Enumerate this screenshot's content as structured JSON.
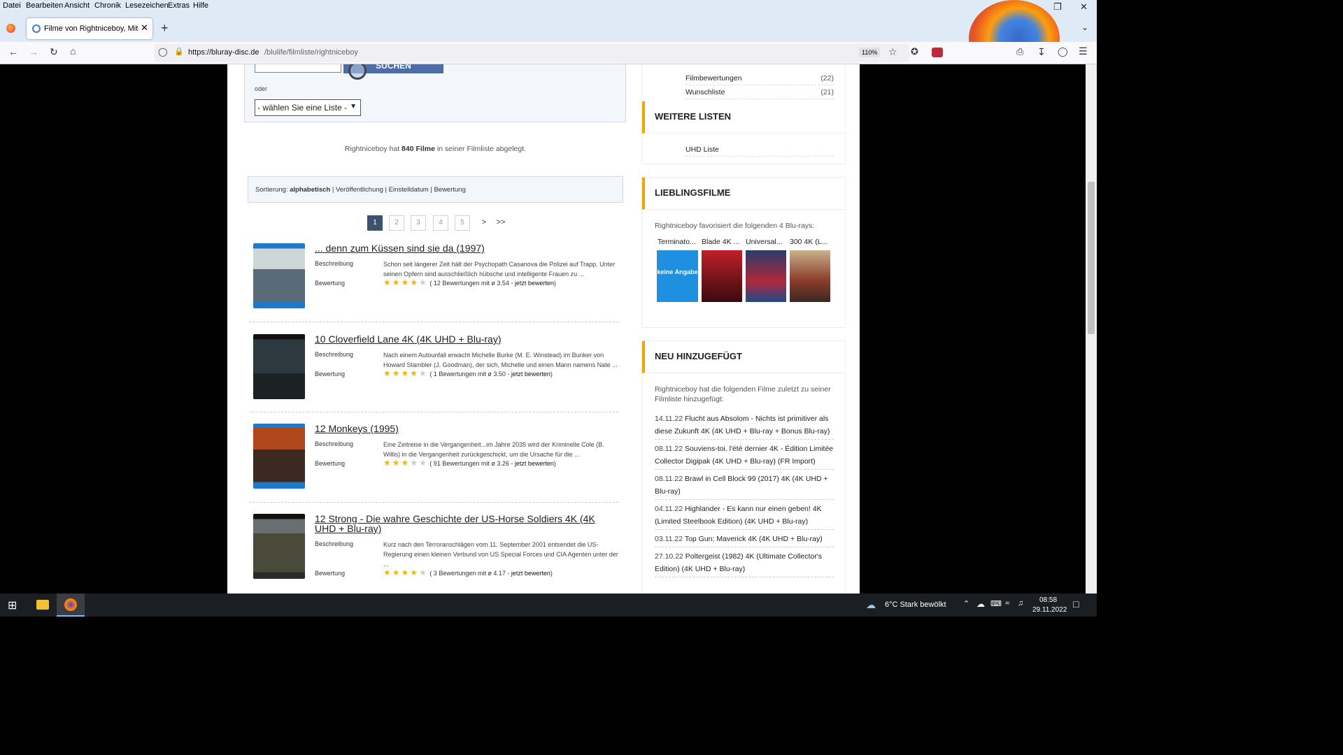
{
  "menu": [
    "Datei",
    "Bearbeiten",
    "Ansicht",
    "Chronik",
    "Lesezeichen",
    "Extras",
    "Hilfe"
  ],
  "tab": {
    "title": "Filme von Rightniceboy, Mitglie"
  },
  "url": {
    "domain": "https://bluray-disc.de",
    "path": "/blulife/filmliste/rightniceboy"
  },
  "zoom": "110%",
  "search": {
    "oder": "oder",
    "button": "SUCHEN",
    "select": "- wählen Sie eine Liste -"
  },
  "summary": {
    "pre": "Rightniceboy hat",
    "count": "840 Filme",
    "post": "in seiner Filmliste abgelegt."
  },
  "sort": {
    "label": "Sortierung:",
    "active": "alphabetisch",
    "opts": [
      "Veröffentlichung",
      "Einstelldatum",
      "Bewertung"
    ]
  },
  "pagination": [
    "1",
    "2",
    "3",
    "4",
    "5",
    ">",
    ">>"
  ],
  "labels": {
    "desc": "Beschreibung",
    "rating": "Bewertung",
    "rate_now": "jetzt bewerten"
  },
  "films": [
    {
      "title": "... denn zum Küssen sind sie da (1997)",
      "desc": "Schon seit längerer Zeit hält der Psychopath Casanova die Polizei auf Trapp. Unter seinen Opfern sind ausschließlich hübsche und intelligente Frauen zu ...",
      "stars": 3.5,
      "rating_text": "( 12 Bewertungen mit ø 3.54 -"
    },
    {
      "title": "10 Cloverfield Lane 4K (4K UHD + Blu-ray)",
      "desc": "Nach einem Autounfall erwacht Michelle Burke (M. E. Winstead) im Bunker von Howard Stambler (J. Goodman), der sich, Michelle und einen Mann namens Nate ...",
      "stars": 3.5,
      "rating_text": "( 1 Bewertungen mit ø 3.50 -"
    },
    {
      "title": "12 Monkeys (1995)",
      "desc": "Eine Zeitreise in die Vergangenheit...im Jahre 2035 wird der Kriminelle Cole (B. Willis) in die Vergangenheit zurückgeschickt, um die Ursache für die ...",
      "stars": 3,
      "rating_text": "( 91 Bewertungen mit ø 3.26 -"
    },
    {
      "title": "12 Strong - Die wahre Geschichte der US-Horse Soldiers 4K (4K UHD + Blu-ray)",
      "desc": "Kurz nach den Terroranschlägen vom 11. September 2001 entsendet die US-Regierung einen kleinen Verbund von US Special Forces und CIA Agenten unter der ...",
      "stars": 4,
      "rating_text": "( 3 Bewertungen mit ø 4.17 -"
    }
  ],
  "sidebar": {
    "top_links": [
      {
        "label": "Filmbewertungen",
        "count": "(22)"
      },
      {
        "label": "Wunschliste",
        "count": "(21)"
      }
    ],
    "weitere": {
      "title": "WEITERE LISTEN",
      "links": [
        "UHD Liste"
      ]
    },
    "lieblings": {
      "title": "LIEBLINGSFILME",
      "intro": "Rightniceboy favorisiert die folgenden 4 Blu-rays:",
      "items": [
        "Terminato...",
        "Blade 4K ...",
        "Universal...",
        "300 4K (L..."
      ],
      "placeholder": "keine Angabe"
    },
    "neu": {
      "title": "NEU HINZUGEFÜGT",
      "intro": "Rightniceboy hat die folgenden Filme zuletzt zu seiner Filmliste hinzugefügt:",
      "entries": [
        {
          "date": "14.11.22",
          "title": "Flucht aus Absolom - Nichts ist primitiver als diese Zukunft 4K (4K UHD + Blu-ray + Bonus Blu-ray)"
        },
        {
          "date": "08.11.22",
          "title": "Souviens-toi. l'été dernier 4K - Édition Limitée Collector Digipak (4K UHD + Blu-ray) (FR Import)"
        },
        {
          "date": "08.11.22",
          "title": "Brawl in Cell Block 99 (2017) 4K (4K UHD + Blu-ray)"
        },
        {
          "date": "04.11.22",
          "title": "Highlander - Es kann nur einen geben! 4K (Limited Steelbook Edition) (4K UHD + Blu-ray)"
        },
        {
          "date": "03.11.22",
          "title": "Top Gun: Maverick 4K (4K UHD + Blu-ray)"
        },
        {
          "date": "27.10.22",
          "title": "Poltergeist (1982) 4K (Ultimate Collector's Edition) (4K UHD + Blu-ray)"
        }
      ]
    }
  },
  "taskbar": {
    "weather": "6°C  Stark bewölkt",
    "time": "08:58",
    "date": "29.11.2022"
  },
  "colors": {
    "accent": "#f0a500",
    "pager_active": "#3c5270",
    "star": "#f2b600"
  }
}
